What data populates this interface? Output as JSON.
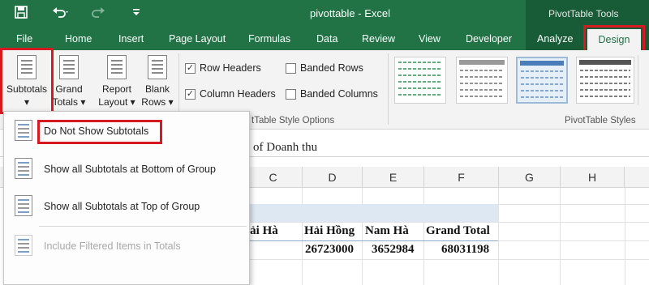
{
  "window": {
    "title": "pivottable - Excel",
    "contextual_group": "PivotTable Tools"
  },
  "qat": {
    "save_icon": "save-icon",
    "undo_icon": "undo-icon",
    "redo_icon": "redo-icon"
  },
  "tabs": [
    "File",
    "Home",
    "Insert",
    "Page Layout",
    "Formulas",
    "Data",
    "Review",
    "View",
    "Developer",
    "Analyze",
    "Design"
  ],
  "ribbon": {
    "layout": {
      "subtotals_line1": "Subtotals",
      "grand_line1": "Grand",
      "grand_line2": "Totals",
      "report_line1": "Report",
      "report_line2": "Layout",
      "blank_line1": "Blank",
      "blank_line2": "Rows",
      "dropdown_arrow": "▾"
    },
    "style_options": {
      "row_headers": "Row Headers",
      "row_headers_checked": "✓",
      "column_headers": "Column Headers",
      "column_headers_checked": "✓",
      "banded_rows": "Banded Rows",
      "banded_columns": "Banded Columns",
      "group_label": "tTable Style Options"
    },
    "styles": {
      "group_label": "PivotTable Styles"
    }
  },
  "formula_bar": {
    "content": "of Doanh thu"
  },
  "sheet": {
    "columns": [
      "C",
      "D",
      "E",
      "F",
      "G",
      "H"
    ],
    "headers": [
      "lải Hà",
      "Hải Hồng",
      "Nam Hà",
      "Grand Total"
    ],
    "values": [
      "26723000",
      "3652984",
      "68031198"
    ]
  },
  "menu": {
    "items": [
      {
        "label": "Do Not Show Subtotals",
        "enabled": true
      },
      {
        "label": "Show all Subtotals at Bottom of Group",
        "enabled": true
      },
      {
        "label": "Show all Subtotals at Top of Group",
        "enabled": true
      },
      {
        "label": "Include Filtered Items in Totals",
        "enabled": false
      }
    ]
  },
  "colors": {
    "excel_green": "#217346",
    "contextual_green": "#185c37",
    "highlight_red": "#d71a21",
    "pivot_band": "#dde8f3"
  }
}
